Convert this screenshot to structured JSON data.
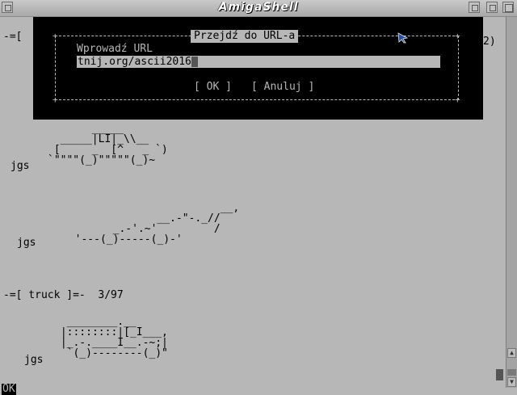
{
  "window": {
    "title": "AmigaShell"
  },
  "terminal": {
    "top_fragment": "-=[ ",
    "right_fragment": "2)",
    "car1_label": "jgs",
    "car1_art": "       _____\n  _____|LI|_\\\\__\n [     _  [^   _ `)\n`\"\"\"\"(_)\"\"\"\"\"(_)~",
    "car2_label": "jgs",
    "car2_art": "                         __,\n               __.-\"-._//\n        _.-'.~'         /\n  '---(_)-----(_)-'",
    "section_header": "-=[ truck ]=-  3/97",
    "truck_label": "jgs",
    "truck_art": "  ________.__\n |::::::::|[_I___,\n |_.-.____I__.-~;|\n  `(_)--------(_)\"",
    "status": "OK"
  },
  "dialog": {
    "title": "Przejdź do URL-a",
    "field_label": "Wprowadź URL",
    "url_value": "tnij.org/ascii2016",
    "ok_label": "[ OK ]",
    "cancel_label": "[ Anuluj ]"
  },
  "icons": {
    "close": "close-icon",
    "depth": "depth-icon",
    "zoom": "zoom-icon",
    "pointer": "mouse-pointer-icon"
  }
}
